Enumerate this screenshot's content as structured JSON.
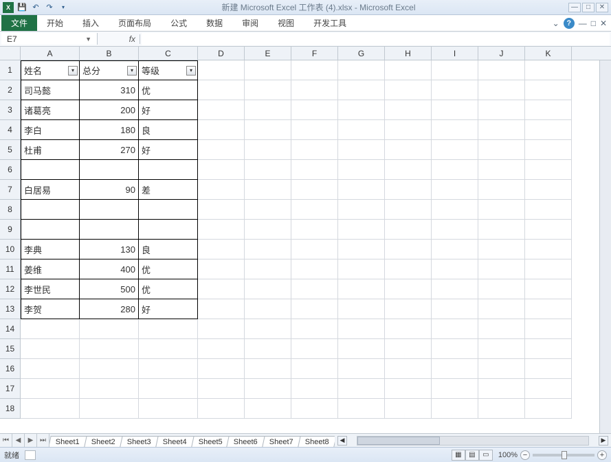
{
  "title": "新建 Microsoft Excel 工作表 (4).xlsx - Microsoft Excel",
  "qat": {
    "save": "💾",
    "undo": "↶",
    "redo": "↷"
  },
  "ribbon": {
    "file": "文件",
    "tabs": [
      "开始",
      "插入",
      "页面布局",
      "公式",
      "数据",
      "审阅",
      "视图",
      "开发工具"
    ]
  },
  "name_box": "E7",
  "fx_label": "fx",
  "formula_value": "",
  "columns": [
    "A",
    "B",
    "C",
    "D",
    "E",
    "F",
    "G",
    "H",
    "I",
    "J",
    "K"
  ],
  "data_region": {
    "headers": [
      "姓名",
      "总分",
      "等级"
    ],
    "rows": [
      {
        "r": 2,
        "name": "司马懿",
        "score": "310",
        "grade": "优"
      },
      {
        "r": 3,
        "name": "诸葛亮",
        "score": "200",
        "grade": "好"
      },
      {
        "r": 4,
        "name": "李白",
        "score": "180",
        "grade": "良"
      },
      {
        "r": 5,
        "name": "杜甫",
        "score": "270",
        "grade": "好"
      },
      {
        "r": 6,
        "name": "",
        "score": "",
        "grade": ""
      },
      {
        "r": 7,
        "name": "白居易",
        "score": "90",
        "grade": "差"
      },
      {
        "r": 8,
        "name": "",
        "score": "",
        "grade": ""
      },
      {
        "r": 9,
        "name": "",
        "score": "",
        "grade": ""
      },
      {
        "r": 10,
        "name": "李典",
        "score": "130",
        "grade": "良"
      },
      {
        "r": 11,
        "name": "姜维",
        "score": "400",
        "grade": "优"
      },
      {
        "r": 12,
        "name": "李世民",
        "score": "500",
        "grade": "优"
      },
      {
        "r": 13,
        "name": "李贺",
        "score": "280",
        "grade": "好"
      }
    ]
  },
  "extra_rows": [
    14,
    15,
    16,
    17,
    18
  ],
  "sheets": [
    "Sheet1",
    "Sheet2",
    "Sheet3",
    "Sheet4",
    "Sheet5",
    "Sheet6",
    "Sheet7",
    "Sheet8"
  ],
  "active_sheet": 0,
  "status": {
    "ready": "就绪",
    "zoom": "100%"
  }
}
